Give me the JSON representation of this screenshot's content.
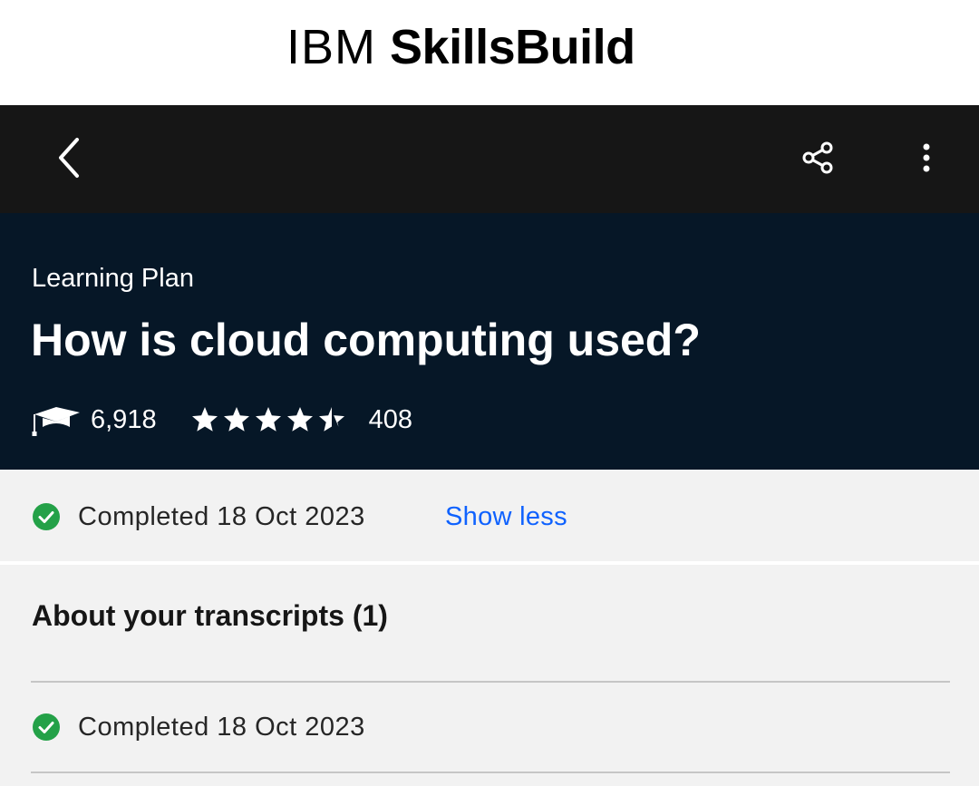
{
  "brand": {
    "name_light": "IBM",
    "name_bold": "SkillsBuild"
  },
  "topbar": {
    "back_icon": "chevron-left-icon",
    "share_icon": "share-icon",
    "more_icon": "overflow-menu-vertical-icon"
  },
  "hero": {
    "label": "Learning Plan",
    "title": "How is cloud computing used?",
    "learners_icon": "graduation-cap-icon",
    "learners_count": "6,918",
    "rating": 4.5,
    "rating_count": "408"
  },
  "status": {
    "completed_text": "Completed 18 Oct 2023",
    "toggle_label": "Show less"
  },
  "transcripts": {
    "heading": "About your transcripts (1)",
    "items": [
      {
        "completed_text": "Completed 18 Oct 2023"
      }
    ]
  },
  "colors": {
    "brand_bg": "#ffffff",
    "topbar_bg": "#161616",
    "hero_bg": "#061727",
    "page_bg": "#f2f2f2",
    "link": "#0f62fe",
    "success": "#24a148"
  }
}
